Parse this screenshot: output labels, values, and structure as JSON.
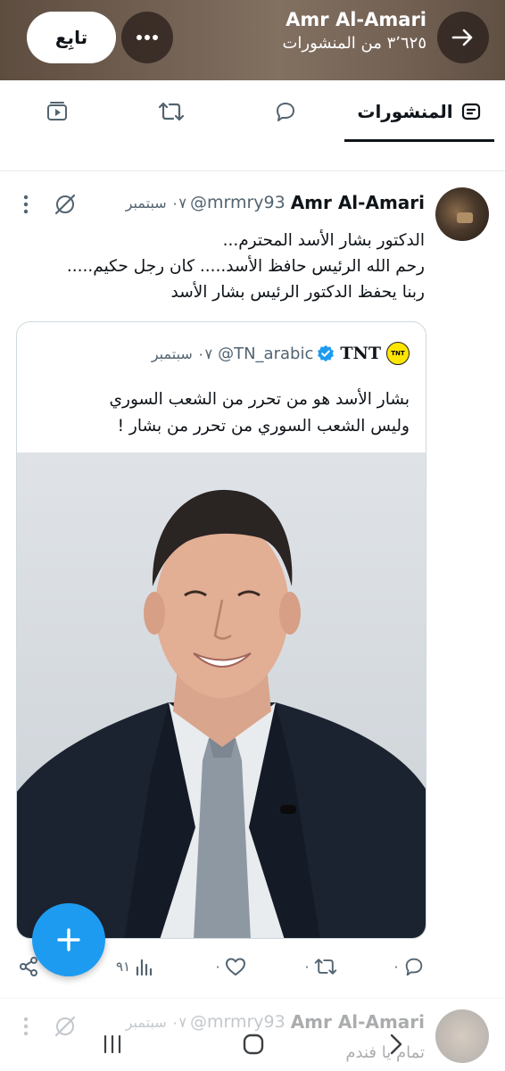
{
  "header": {
    "name": "Amr Al-Amari",
    "post_count": "٣٬٦٢٥ من المنشورات",
    "follow_label": "تابِع",
    "back_icon": "arrow-right-icon",
    "more_icon": "more-horizontal-icon"
  },
  "tabs": [
    {
      "label": "المنشورات",
      "icon": "posts-icon",
      "active": true
    },
    {
      "label": "",
      "icon": "reply-icon",
      "active": false
    },
    {
      "label": "",
      "icon": "repost-icon",
      "active": false
    },
    {
      "label": "",
      "icon": "media-icon",
      "active": false
    }
  ],
  "tweet": {
    "name": "Amr Al-Amari",
    "handle": "@mrmry93",
    "date": "٠٧ سبتمبر",
    "lines": [
      "الدكتور بشار الأسد المحترم...",
      "رحم الله الرئيس حافظ الأسد..... كان رجل حكيم.....",
      "ربنا يحفظ الدكتور الرئيس بشار الأسد"
    ],
    "quote": {
      "logo_text": "TNT",
      "name": "TNT",
      "handle": "@TN_arabic",
      "date": "٠٧ سبتمبر",
      "lines": [
        "بشار الأسد هو من تحرر من الشعب السوري",
        "وليس الشعب السوري من تحرر من بشار !"
      ]
    },
    "actions": {
      "reply_count": "٠",
      "repost_count": "٠",
      "like_count": "٠",
      "views_count": "٩١"
    }
  },
  "next_tweet": {
    "name": "Amr Al-Amari",
    "handle": "@mrmry93",
    "date": "٠٧ سبتمبر",
    "text": "تمام يا فندم"
  },
  "colors": {
    "accent": "#1d9bf0",
    "text_primary": "#0f1419",
    "text_secondary": "#536471",
    "verified": "#1d9bf0",
    "tnt_logo": "#ffe600"
  }
}
